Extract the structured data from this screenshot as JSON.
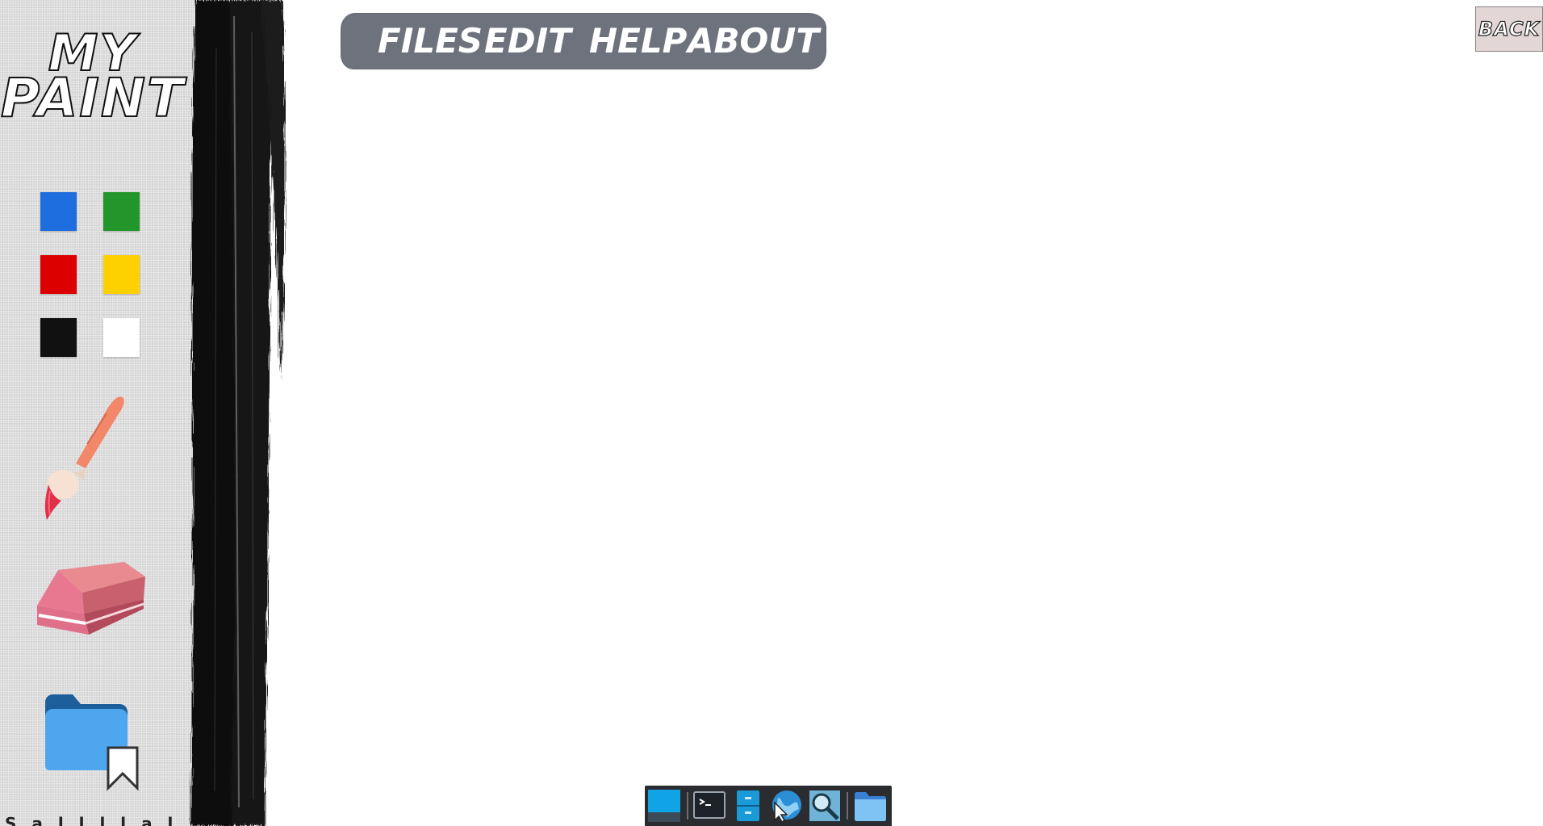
{
  "app": {
    "title_line1": "MY",
    "title_line2": "PAINT"
  },
  "menu": {
    "items": [
      {
        "id": "files",
        "label": "FILES"
      },
      {
        "id": "edit",
        "label": "EDIT"
      },
      {
        "id": "help",
        "label": "HELP"
      },
      {
        "id": "about",
        "label": "ABOUT"
      }
    ]
  },
  "back_button": {
    "label": "BACK"
  },
  "palette": {
    "colors": [
      {
        "name": "blue",
        "hex": "#1f6ee0"
      },
      {
        "name": "green",
        "hex": "#22962a"
      },
      {
        "name": "red",
        "hex": "#dc0000"
      },
      {
        "name": "yellow",
        "hex": "#ffd000"
      },
      {
        "name": "black",
        "hex": "#111111"
      },
      {
        "name": "white",
        "hex": "#ffffff"
      }
    ]
  },
  "tools": {
    "brush_icon": "paint-brush-icon",
    "eraser_icon": "eraser-icon",
    "folder_icon": "bookmarked-folder-icon"
  },
  "bottom_label": "S a l l l l a l",
  "taskbar": {
    "icons": [
      "show-desktop-icon",
      "terminal-icon",
      "file-cabinet-icon",
      "web-browser-icon",
      "search-icon",
      "file-manager-icon"
    ]
  }
}
